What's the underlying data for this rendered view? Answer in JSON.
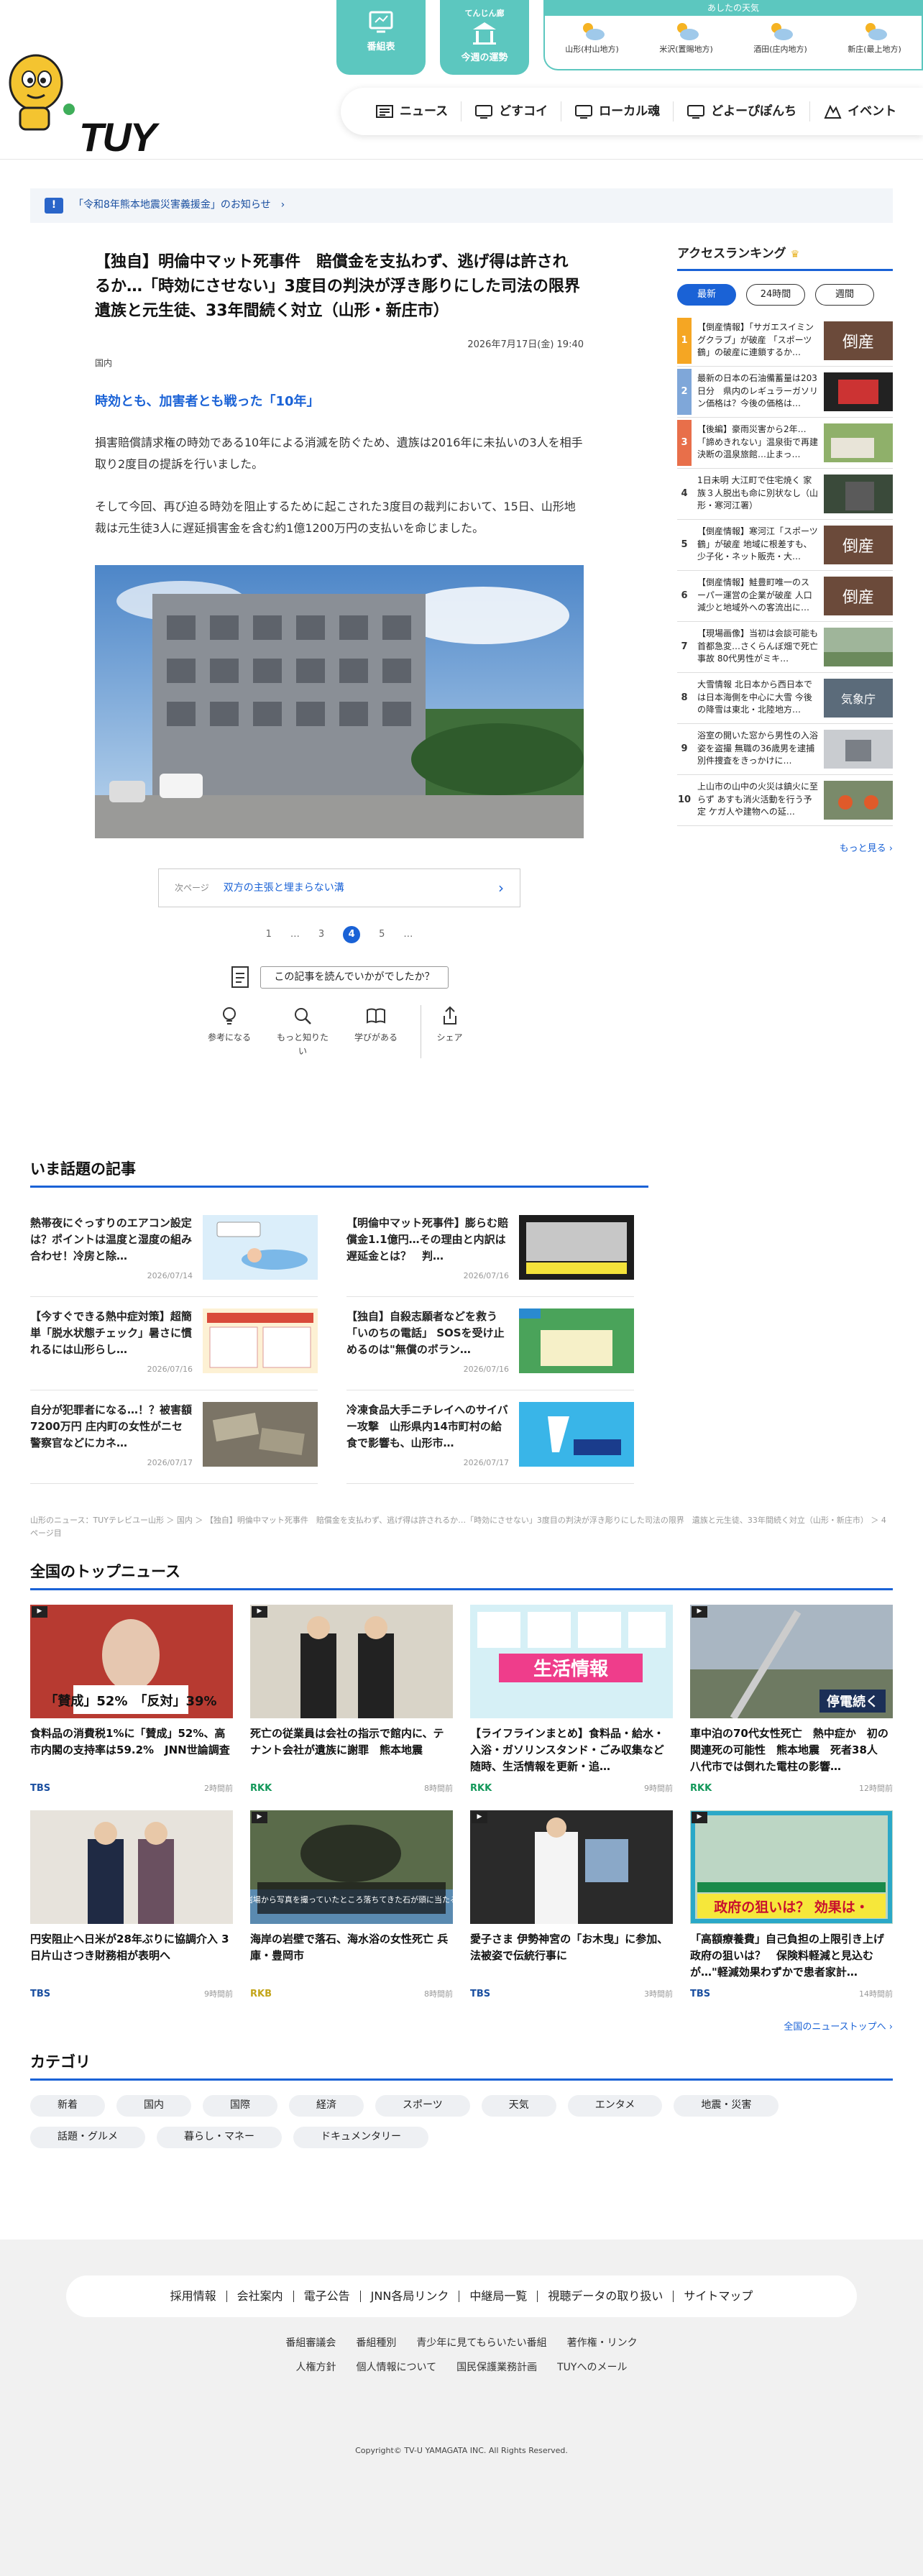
{
  "header": {
    "logo_text": "TUY",
    "program_btn": "番組表",
    "weekly_btn_small": "てんじん廊",
    "weekly_btn": "今週の運勢",
    "weather_title": "あしたの天気",
    "weather": [
      {
        "area": "山形(村山地方)",
        "icon": "cloud-sun-icon"
      },
      {
        "area": "米沢(置賜地方)",
        "icon": "cloud-sun-icon"
      },
      {
        "area": "酒田(庄内地方)",
        "icon": "cloud-sun-icon"
      },
      {
        "area": "新庄(最上地方)",
        "icon": "cloud-sun-icon"
      }
    ],
    "nav": [
      {
        "label": "ニュース",
        "icon": "news-icon"
      },
      {
        "label": "どすコイ",
        "icon": "tv-icon"
      },
      {
        "label": "ローカル魂",
        "icon": "tv-icon"
      },
      {
        "label": "どよーぴぽんち",
        "icon": "tv-icon"
      },
      {
        "label": "イベント",
        "icon": "event-icon"
      }
    ]
  },
  "notice": {
    "mark": "!",
    "text": "「令和8年熊本地震災害義援金」のお知らせ",
    "arrow": "›"
  },
  "article": {
    "title": "【独自】明倫中マット死事件　賠償金を支払わず、逃げ得は許されるか…「時効にさせない」3度目の判決が浮き彫りにした司法の限界　遺族と元生徒、33年間続く対立（山形・新庄市）",
    "date": "2026年7月17日(金) 19:40",
    "category": "国内",
    "subheading": "時効とも、加害者とも戦った「10年」",
    "para1": "損害賠償請求権の時効である10年による消滅を防ぐため、遺族は2016年に未払いの3人を相手取り2度目の提訴を行いました。",
    "para2": "そして今回、再び迫る時効を阻止するために起こされた3度目の裁判において、15日、山形地裁は元生徒3人に遅延損害金を含む約1億1200万円の支払いを命じました。",
    "next_label": "次ページ",
    "next_title": "双方の主張と埋まらない溝",
    "next_arrow": "›",
    "pager": [
      "1",
      "…",
      "3",
      "4",
      "5",
      "…"
    ],
    "feedback_q": "この記事を読んでいかがでしたか？",
    "reactions": [
      {
        "label": "参考になる"
      },
      {
        "label": "もっと知りたい"
      },
      {
        "label": "学びがある"
      },
      {
        "label": "シェア"
      }
    ]
  },
  "ranking": {
    "title": "アクセスランキング",
    "tabs": [
      "最新",
      "24時間",
      "週間"
    ],
    "items": [
      {
        "num": "1",
        "text": "【倒産情報】「サガエスイミングクラブ」が破産 「スポーツ鶴」の破産に連鎖するか…",
        "thumb": "倒産"
      },
      {
        "num": "2",
        "text": "最新の日本の石油備蓄量は203日分　県内のレギュラーガソリン価格は？今後の価格は…",
        "thumb": ""
      },
      {
        "num": "3",
        "text": "【後編】豪雨災害から2年…「諦めきれない」温泉街で再建決断の温泉旅館…止まっ…",
        "thumb": ""
      },
      {
        "num": "4",
        "text": "1日未明 大江町で住宅焼く 家族３人脱出も命に別状なし（山形・寒河江署）",
        "thumb": ""
      },
      {
        "num": "5",
        "text": "【倒産情報】寒河江「スポーツ鶴」が破産 地域に根差すも、少子化・ネット販売・大…",
        "thumb": "倒産"
      },
      {
        "num": "6",
        "text": "【倒産情報】鮭豊町唯一のスーパー運営の企業が破産 人口減少と地域外への客流出に…",
        "thumb": "倒産"
      },
      {
        "num": "7",
        "text": "【現場画像】当初は会談可能も首都急変…さくらんぼ畑で死亡事故 80代男性がミキ…",
        "thumb": ""
      },
      {
        "num": "8",
        "text": "大雪情報 北日本から西日本で は日本海側を中心に大雪 今後の降雪は東北・北陸地方…",
        "thumb": "気象庁"
      },
      {
        "num": "9",
        "text": "浴室の開いた窓から男性の入浴姿を盗撮 無職の36歳男を逮捕　別件捜査をきっかけに…",
        "thumb": ""
      },
      {
        "num": "10",
        "text": "上山市の山中の火災は鎮火に至らず あすも消火活動を行う予定 ケガ人や建物への延…",
        "thumb": ""
      }
    ],
    "more": "もっと見る ›"
  },
  "trending": {
    "title": "いま話題の記事",
    "items": [
      {
        "title": "熱帯夜にぐっすりのエアコン設定は？ポイントは温度と湿度の組み合わせ！冷房と除…",
        "date": "2026/07/14"
      },
      {
        "title": "【明倫中マット死事件】膨らむ賠償金1.1億円…その理由と内訳は　遅延金とは？　判…",
        "date": "2026/07/16"
      },
      {
        "title": "【今すぐできる熱中症対策】超簡単「脱水状態チェック」暑さに慣れるには山形らし…",
        "date": "2026/07/16"
      },
      {
        "title": "【独自】自殺志願者などを救う「いのちの電話」 SOSを受け止めるのは\"無償のボラン…",
        "date": "2026/07/16"
      },
      {
        "title": "自分が犯罪者になる…！？被害額7200万円 庄内町の女性がニセ警察官などにカネ…",
        "date": "2026/07/17"
      },
      {
        "title": "冷凍食品大手ニチレイへのサイバー攻撃　山形県内14市町村の給食で影響も、山形市…",
        "date": "2026/07/17"
      }
    ]
  },
  "breadcrumb": "山形のニュース：TUYテレビユー山形 ＞ 国内 ＞ 【独自】明倫中マット死事件　賠償金を支払わず、逃げ得は許されるか…「時効にさせない」3度目の判決が浮き彫りにした司法の限界　遺族と元生徒、33年間続く対立（山形・新庄市） ＞ 4ページ目",
  "national": {
    "title": "全国のトップニュース",
    "items": [
      {
        "title": "食料品の消費税1%に「賛成」52%、高市内閣の支持率は59.2%　JNN世論調査",
        "src": "TBS",
        "time": "2時間前",
        "thumb_text": "「賛成」52%　「反対」39%"
      },
      {
        "title": "死亡の従業員は会社の指示で館内に、テナント会社が遺族に謝罪　熊本地震",
        "src": "RKK",
        "time": "8時間前",
        "thumb_text": ""
      },
      {
        "title": "【ライフラインまとめ】食料品・給水・入浴・ガソリンスタンド・ごみ収集など　随時、生活情報を更新・追…",
        "src": "RKK",
        "time": "9時間前",
        "thumb_text": "生活情報"
      },
      {
        "title": "車中泊の70代女性死亡　熱中症か　初の関連死の可能性　熊本地震　死者38人　八代市では倒れた電柱の影響…",
        "src": "RKK",
        "time": "12時間前",
        "thumb_text": "停電続く"
      },
      {
        "title": "円安阻止へ日米が28年ぶりに協調介入 3日片山さつき財務相が表明へ",
        "src": "TBS",
        "time": "9時間前",
        "thumb_text": ""
      },
      {
        "title": "海岸の岩壁で落石、海水浴の女性死亡 兵庫・豊岡市",
        "src": "RKB",
        "time": "8時間前",
        "thumb_text": "岩場から写真を撮っていたところ落ちてきた石が頭に当たる"
      },
      {
        "title": "愛子さま 伊勢神宮の「お木曳」に参加、法被姿で伝統行事に",
        "src": "TBS",
        "time": "3時間前",
        "thumb_text": ""
      },
      {
        "title": "「高額療養費」自己負担の上限引き上げ　政府の狙いは？　保険料軽減と見込むが…\"軽減効果わずかで患者家計…",
        "src": "TBS",
        "time": "14時間前",
        "thumb_text": "政府の狙いは？ 効果は・"
      }
    ],
    "more": "全国のニューストップへ ›"
  },
  "category": {
    "title": "カテゴリ",
    "tags": [
      "新着",
      "国内",
      "国際",
      "経済",
      "スポーツ",
      "天気",
      "エンタメ",
      "地震・災害",
      "話題・グルメ",
      "暮らし・マネー",
      "ドキュメンタリー"
    ]
  },
  "footer": {
    "main_links": [
      "採用情報",
      "会社案内",
      "電子公告",
      "JNN各局リンク",
      "中継局一覧",
      "視聴データの取り扱い",
      "サイトマップ"
    ],
    "row1": [
      "番組審議会",
      "番組種別",
      "青少年に見てもらいたい番組",
      "著作権・リンク"
    ],
    "row2": [
      "人権方針",
      "個人情報について",
      "国民保護業務計画",
      "TUYへのメール"
    ],
    "copyright": "Copyright© TV-U YAMAGATA INC. All Rights Reserved."
  },
  "colors": {
    "accent": "#1a62d6",
    "teal": "#5cc7bf",
    "rank1": "#f5a623",
    "rank2": "#7fa7d9",
    "rank3": "#e86f4a"
  }
}
